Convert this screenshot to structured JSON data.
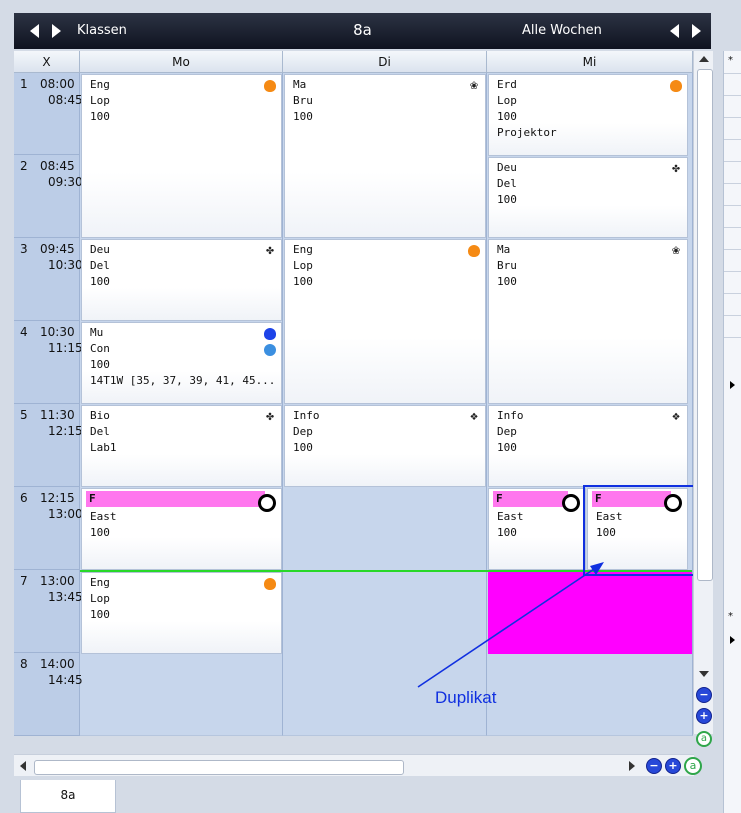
{
  "toolbar": {
    "left_label": "Klassen",
    "title": "8a",
    "right_label": "Alle Wochen"
  },
  "header": {
    "corner": "X",
    "days": [
      "Mo",
      "Di",
      "Mi"
    ]
  },
  "periods": [
    {
      "num": "1",
      "start": "08:00",
      "end": "08:45"
    },
    {
      "num": "2",
      "start": "08:45",
      "end": "09:30"
    },
    {
      "num": "3",
      "start": "09:45",
      "end": "10:30"
    },
    {
      "num": "4",
      "start": "10:30",
      "end": "11:15"
    },
    {
      "num": "5",
      "start": "11:30",
      "end": "12:15"
    },
    {
      "num": "6",
      "start": "12:15",
      "end": "13:00"
    },
    {
      "num": "7",
      "start": "13:00",
      "end": "13:45"
    },
    {
      "num": "8",
      "start": "14:00",
      "end": "14:45"
    }
  ],
  "lessons": {
    "mo_1": {
      "lines": [
        "Eng",
        "Lop",
        "100"
      ],
      "icon": "apple-orange-icon"
    },
    "di_1": {
      "lines": [
        "Ma",
        "Bru",
        "100"
      ],
      "icon": "flower-icon"
    },
    "mi_1": {
      "lines": [
        "Erd",
        "Lop",
        "100",
        "Projektor"
      ],
      "icon": "apple-orange-icon"
    },
    "mi_2": {
      "lines": [
        "Deu",
        "Del",
        "100"
      ],
      "icon": "snowflake-icon"
    },
    "mo_3": {
      "lines": [
        "Deu",
        "Del",
        "100"
      ],
      "icon": "snowflake-icon"
    },
    "di_3": {
      "lines": [
        "Eng",
        "Lop",
        "100"
      ],
      "icon": "apple-orange-icon"
    },
    "mi_3": {
      "lines": [
        "Ma",
        "Bru",
        "100"
      ],
      "icon": "flower-icon"
    },
    "mo_4": {
      "lines": [
        "Mu",
        "Con",
        "100",
        "14T1W [35, 37, 39, 41, 45..."
      ],
      "icon": "apple-blue-icon"
    },
    "mo_5": {
      "lines": [
        "Bio",
        "Del",
        "Lab1"
      ],
      "icon": "snowflake-icon"
    },
    "di_5": {
      "lines": [
        "Info",
        "Dep",
        "100"
      ],
      "icon": "diamond-dots-icon"
    },
    "mi_5": {
      "lines": [
        "Info",
        "Dep",
        "100"
      ],
      "icon": "diamond-dots-icon"
    },
    "mo_6": {
      "lines": [
        "F",
        "East",
        "100"
      ],
      "icon": "ring-icon"
    },
    "mi_6": {
      "lines": [
        "F",
        "East",
        "100"
      ],
      "icon": "ring-icon"
    },
    "dup_6": {
      "lines": [
        "F",
        "East",
        "100"
      ],
      "icon": "ring-icon"
    },
    "mo_7": {
      "lines": [
        "Eng",
        "Lop",
        "100"
      ],
      "icon": "apple-orange-icon"
    }
  },
  "annotation": {
    "text": "Duplikat"
  },
  "tabs": [
    {
      "label": "8a"
    }
  ],
  "colors": {
    "highlight_block": "#ff00ff",
    "f_bar": "#ff77ee",
    "annotation_blue": "#1030e0",
    "current_time_line": "#28d828"
  }
}
